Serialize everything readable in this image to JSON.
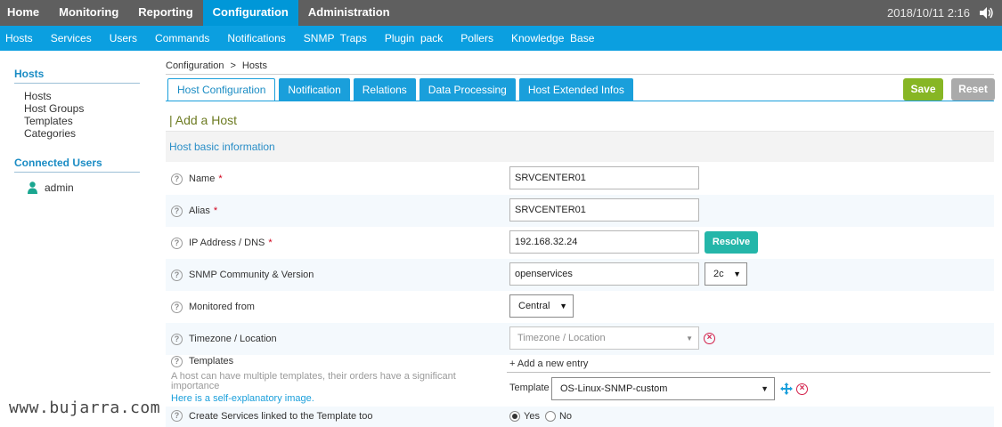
{
  "topbar": {
    "menu": [
      "Home",
      "Monitoring",
      "Reporting",
      "Configuration",
      "Administration"
    ],
    "active": "Configuration",
    "datetime": "2018/10/11 2:16",
    "sound_icon": "speaker-icon"
  },
  "subbar": {
    "items": [
      "Hosts",
      "Services",
      "Users",
      "Commands",
      "Notifications",
      "SNMP  Traps",
      "Plugin  pack",
      "Pollers",
      "Knowledge  Base"
    ]
  },
  "sidebar": {
    "hosts_title": "Hosts",
    "hosts_links": [
      "Hosts",
      "Host Groups",
      "Templates",
      "Categories"
    ],
    "users_title": "Connected Users",
    "users": [
      {
        "name": "admin",
        "icon": "user-icon"
      }
    ]
  },
  "breadcrumb": [
    "Configuration",
    "Hosts"
  ],
  "breadcrumb_sep": ">",
  "tabs": [
    "Host Configuration",
    "Notification",
    "Relations",
    "Data Processing",
    "Host Extended Infos"
  ],
  "actions": {
    "save": "Save",
    "reset": "Reset"
  },
  "form": {
    "title": "| Add a Host",
    "section": "Host basic information",
    "help_glyph": "?",
    "required_mark": "*",
    "name": {
      "label": "Name",
      "value": "SRVCENTER01"
    },
    "alias": {
      "label": "Alias",
      "value": "SRVCENTER01"
    },
    "ip": {
      "label": "IP Address / DNS",
      "value": "192.168.32.24",
      "resolve": "Resolve"
    },
    "snmp": {
      "label": "SNMP Community & Version",
      "value": "openservices",
      "version": "2c"
    },
    "monitored_from": {
      "label": "Monitored from",
      "value": "Central"
    },
    "timezone": {
      "label": "Timezone / Location",
      "placeholder": "Timezone / Location"
    },
    "templates": {
      "label": "Templates",
      "hint": "A host can have multiple templates, their orders have a significant importance",
      "hint_link": "Here is a self-explanatory image.",
      "add_entry": "+ Add a new entry",
      "template_label": "Template",
      "template_value": "OS-Linux-SNMP-custom"
    },
    "create_services": {
      "label": "Create Services linked to the Template too",
      "yes": "Yes",
      "no": "No",
      "selected": "Yes"
    }
  },
  "watermark": "www.bujarra.com",
  "colors": {
    "top": "#5f5f5f",
    "accent": "#0097d8",
    "save": "#87b624",
    "resolve": "#24b6a9",
    "remove": "#d3204a"
  }
}
